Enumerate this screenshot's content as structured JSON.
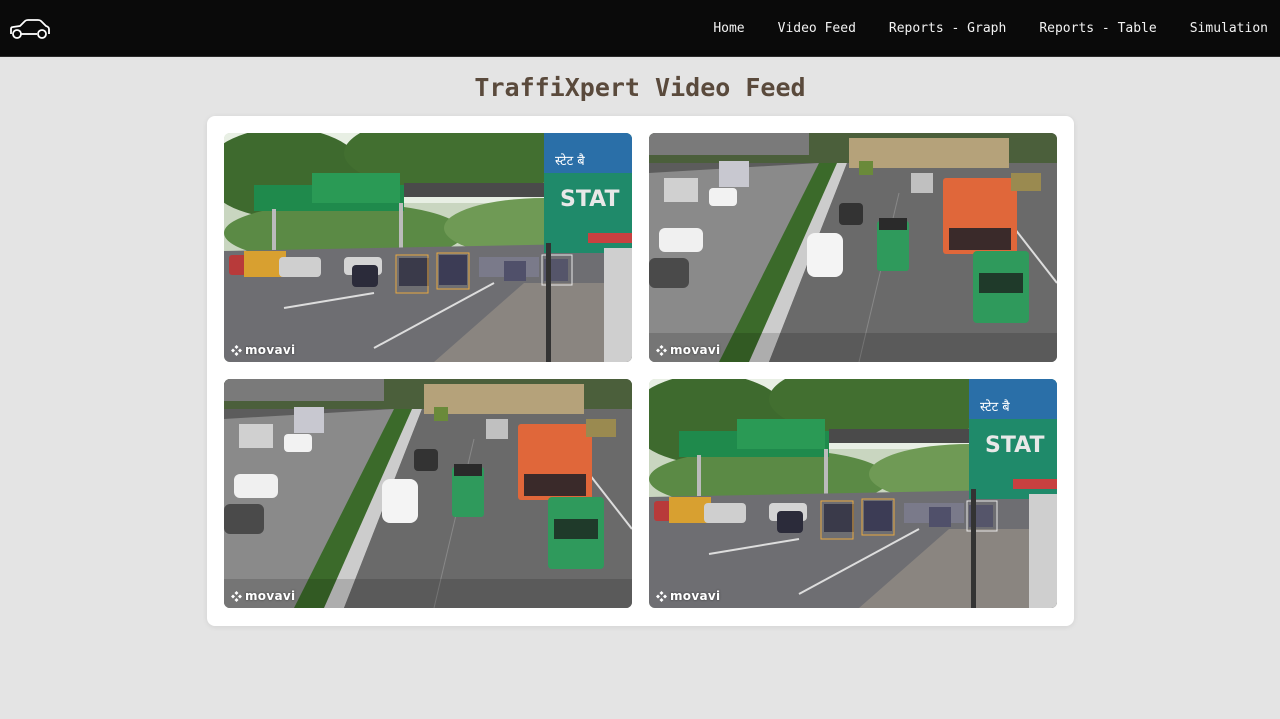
{
  "nav": {
    "logo_icon": "car-icon",
    "links": [
      {
        "label": "Home"
      },
      {
        "label": "Video Feed"
      },
      {
        "label": "Reports - Graph"
      },
      {
        "label": "Reports - Table"
      },
      {
        "label": "Simulation"
      }
    ]
  },
  "page": {
    "title": "TraffiXpert Video Feed"
  },
  "feeds": [
    {
      "scene": "intersection",
      "watermark": "movavi",
      "sign_text": "STAT",
      "sign_hindi": "स्टेट बै"
    },
    {
      "scene": "highway",
      "watermark": "movavi"
    },
    {
      "scene": "highway",
      "watermark": "movavi"
    },
    {
      "scene": "intersection",
      "watermark": "movavi",
      "sign_text": "STAT",
      "sign_hindi": "स्टेट बै"
    }
  ],
  "colors": {
    "nav_bg": "#0a0a0a",
    "page_bg": "#e4e4e4",
    "title": "#5a4a3c",
    "bus": "#e0673a",
    "auto_rickshaw": "#2f9a5c",
    "sign_green": "#1f8a4c"
  }
}
